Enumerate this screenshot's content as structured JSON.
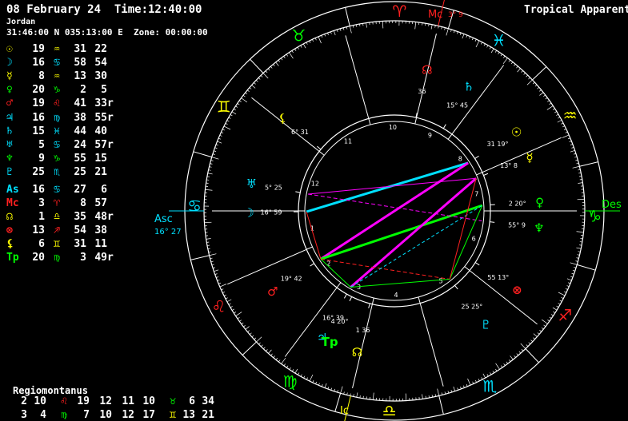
{
  "header": {
    "date_time": "08 February 24  Time:12:40:00",
    "place": "Jordan",
    "coords": "31:46:00 N 035:13:00 E  Zone: 00:00:00",
    "mode": "Tropical Apparent"
  },
  "planets": [
    {
      "glyph": "☉",
      "name": "Sun",
      "deg": "19",
      "sign": "♒",
      "min": "31",
      "sec": "22",
      "r": "",
      "gc": "#ffff00",
      "sc": "#ffff00"
    },
    {
      "glyph": "☽",
      "name": "Moon",
      "deg": "16",
      "sign": "♋",
      "min": "58",
      "sec": "54",
      "r": "",
      "gc": "#00e0ff",
      "sc": "#00e0ff"
    },
    {
      "glyph": "☿",
      "name": "Mercury",
      "deg": "8",
      "sign": "♒",
      "min": "13",
      "sec": "30",
      "r": "",
      "gc": "#ffff00",
      "sc": "#ffff00"
    },
    {
      "glyph": "♀",
      "name": "Venus",
      "deg": "20",
      "sign": "♑",
      "min": "2",
      "sec": "5",
      "r": "",
      "gc": "#00ff00",
      "sc": "#00ff00"
    },
    {
      "glyph": "♂",
      "name": "Mars",
      "deg": "19",
      "sign": "♌",
      "min": "41",
      "sec": "33",
      "r": "r",
      "gc": "#ff2020",
      "sc": "#ff2020"
    },
    {
      "glyph": "♃",
      "name": "Jupiter",
      "deg": "16",
      "sign": "♍",
      "min": "38",
      "sec": "55",
      "r": "r",
      "gc": "#00e0ff",
      "sc": "#00e0ff"
    },
    {
      "glyph": "♄",
      "name": "Saturn",
      "deg": "15",
      "sign": "♓",
      "min": "44",
      "sec": "40",
      "r": "",
      "gc": "#00e0ff",
      "sc": "#00e0ff"
    },
    {
      "glyph": "♅",
      "name": "Uranus",
      "deg": "5",
      "sign": "♋",
      "min": "24",
      "sec": "57",
      "r": "r",
      "gc": "#00e0ff",
      "sc": "#00e0ff"
    },
    {
      "glyph": "♆",
      "name": "Neptune",
      "deg": "9",
      "sign": "♑",
      "min": "55",
      "sec": "15",
      "r": "",
      "gc": "#00ff00",
      "sc": "#00ff00"
    },
    {
      "glyph": "♇",
      "name": "Pluto",
      "deg": "25",
      "sign": "♏",
      "min": "25",
      "sec": "21",
      "r": "",
      "gc": "#00e0ff",
      "sc": "#00e0ff"
    }
  ],
  "points": [
    {
      "glyph": "As",
      "name": "Ascendant",
      "deg": "16",
      "sign": "♋",
      "min": "27",
      "sec": "6",
      "r": "",
      "gc": "#00e0ff",
      "sc": "#00e0ff"
    },
    {
      "glyph": "Mc",
      "name": "Midheaven",
      "deg": "3",
      "sign": "♈",
      "min": "8",
      "sec": "57",
      "r": "",
      "gc": "#ff2020",
      "sc": "#ff2020"
    },
    {
      "glyph": "☊",
      "name": "Node",
      "deg": "1",
      "sign": "♎",
      "min": "35",
      "sec": "48",
      "r": "r",
      "gc": "#ffff00",
      "sc": "#ffff00"
    },
    {
      "glyph": "⊗",
      "name": "Fortune",
      "deg": "13",
      "sign": "♐",
      "min": "54",
      "sec": "38",
      "r": "",
      "gc": "#ff2020",
      "sc": "#ff2020"
    },
    {
      "glyph": "⚸",
      "name": "Lilith",
      "deg": "6",
      "sign": "♊",
      "min": "31",
      "sec": "11",
      "r": "",
      "gc": "#ffff00",
      "sc": "#ffff00"
    },
    {
      "glyph": "Tp",
      "name": "Tp",
      "deg": "20",
      "sign": "♍",
      "min": "3",
      "sec": "49",
      "r": "r",
      "gc": "#00ff00",
      "sc": "#00ff00"
    }
  ],
  "house_system": "Regiomontanus",
  "cusps_row1": [
    {
      "t": "2"
    },
    {
      "t": "10"
    },
    {
      "t": "♌",
      "c": "#ff2020"
    },
    {
      "t": "19"
    },
    {
      "t": "12"
    },
    {
      "t": "11"
    },
    {
      "t": "10"
    },
    {
      "t": "♉",
      "c": "#00ff00"
    },
    {
      "t": "6"
    },
    {
      "t": "34"
    }
  ],
  "cusps_row2": [
    {
      "t": "3"
    },
    {
      "t": "4"
    },
    {
      "t": "♍",
      "c": "#00ff00"
    },
    {
      "t": "7"
    },
    {
      "t": "10"
    },
    {
      "t": "12"
    },
    {
      "t": "17"
    },
    {
      "t": "♊",
      "c": "#ffff00"
    },
    {
      "t": "13"
    },
    {
      "t": "21"
    }
  ],
  "axes": {
    "asc": "Asc",
    "asc_deg": "16° 27",
    "desc": "Des",
    "mc": "Mc",
    "mc_deg": "3° 9",
    "ic": "Ic"
  },
  "zodiac": [
    {
      "g": "♈",
      "c": "#ff2020"
    },
    {
      "g": "♉",
      "c": "#00ff00"
    },
    {
      "g": "♊",
      "c": "#ffff00"
    },
    {
      "g": "♋",
      "c": "#00e0ff"
    },
    {
      "g": "♌",
      "c": "#ff2020"
    },
    {
      "g": "♍",
      "c": "#00ff00"
    },
    {
      "g": "♎",
      "c": "#ffff00"
    },
    {
      "g": "♏",
      "c": "#00e0ff"
    },
    {
      "g": "♐",
      "c": "#ff2020"
    },
    {
      "g": "♑",
      "c": "#00ff00"
    },
    {
      "g": "♒",
      "c": "#ffff00"
    },
    {
      "g": "♓",
      "c": "#00e0ff"
    }
  ],
  "house_numbers": [
    "1",
    "2",
    "3",
    "4",
    "5",
    "6",
    "7",
    "8",
    "9",
    "10",
    "11",
    "12"
  ],
  "wheel_planets": [
    {
      "g": "☽",
      "lon": 106.98,
      "lab": "16° 59",
      "c": "#00e0ff"
    },
    {
      "g": "♅",
      "lon": 95.42,
      "lab": "5° 25",
      "c": "#00e0ff"
    },
    {
      "g": "⚸",
      "lon": 66.52,
      "lab": "6° 31",
      "c": "#ffff00"
    },
    {
      "g": "☿",
      "lon": 308.22,
      "lab": "13° 8",
      "c": "#ffff00"
    },
    {
      "g": "☉",
      "lon": 319.52,
      "lab": "31 19°",
      "c": "#ffff00"
    },
    {
      "g": "♀",
      "lon": 290.03,
      "lab": "2 20°",
      "c": "#00ff00"
    },
    {
      "g": "♆",
      "lon": 279.92,
      "lab": "55° 9",
      "c": "#00ff00"
    },
    {
      "g": "⊗",
      "lon": 253.91,
      "lab": "55 13°",
      "c": "#ff2020"
    },
    {
      "g": "♇",
      "lon": 235.42,
      "lab": "25 25°",
      "c": "#00e0ff"
    },
    {
      "g": "☊",
      "lon": 181.6,
      "lab": "1 36",
      "c": "#ffff00"
    },
    {
      "g": "♃",
      "lon": 166.65,
      "lab": "16° 39",
      "c": "#00e0ff"
    },
    {
      "g": "Tp",
      "lon": 170.06,
      "lab": "4 20°",
      "c": "#00ff00"
    },
    {
      "g": "♂",
      "lon": 139.69,
      "lab": "19° 42",
      "c": "#ff2020"
    },
    {
      "g": "♄",
      "lon": 345.75,
      "lab": "15° 45",
      "c": "#00e0ff"
    },
    {
      "g": "☊",
      "lon": 3.5,
      "lab": "36",
      "c": "#ff2020"
    }
  ],
  "aspects": [
    {
      "a": 106.98,
      "b": 319.52,
      "c": "#00e0ff",
      "w": 3
    },
    {
      "a": 139.69,
      "b": 319.52,
      "c": "#ff00ff",
      "w": 3
    },
    {
      "a": 139.69,
      "b": 290.03,
      "c": "#00ff00",
      "w": 3
    },
    {
      "a": 166.65,
      "b": 308.22,
      "c": "#ff00ff",
      "w": 3
    },
    {
      "a": 139.69,
      "b": 235.42,
      "c": "#ff2020",
      "w": 1,
      "dash": "5,3"
    },
    {
      "a": 166.65,
      "b": 290.03,
      "c": "#00e0ff",
      "w": 1,
      "dash": "4,3"
    },
    {
      "a": 95.42,
      "b": 308.22,
      "c": "#ff00ff",
      "w": 1
    },
    {
      "a": 95.42,
      "b": 279.92,
      "c": "#ff00ff",
      "w": 1,
      "dash": "5,3"
    },
    {
      "a": 166.65,
      "b": 235.42,
      "c": "#00ff00",
      "w": 1
    },
    {
      "a": 235.42,
      "b": 290.03,
      "c": "#00ff00",
      "w": 1
    },
    {
      "a": 235.42,
      "b": 308.22,
      "c": "#ff2020",
      "w": 1
    },
    {
      "a": 139.69,
      "b": 166.65,
      "c": "#00ff00",
      "w": 1
    },
    {
      "a": 106.98,
      "b": 139.69,
      "c": "#ff2020",
      "w": 1
    }
  ]
}
